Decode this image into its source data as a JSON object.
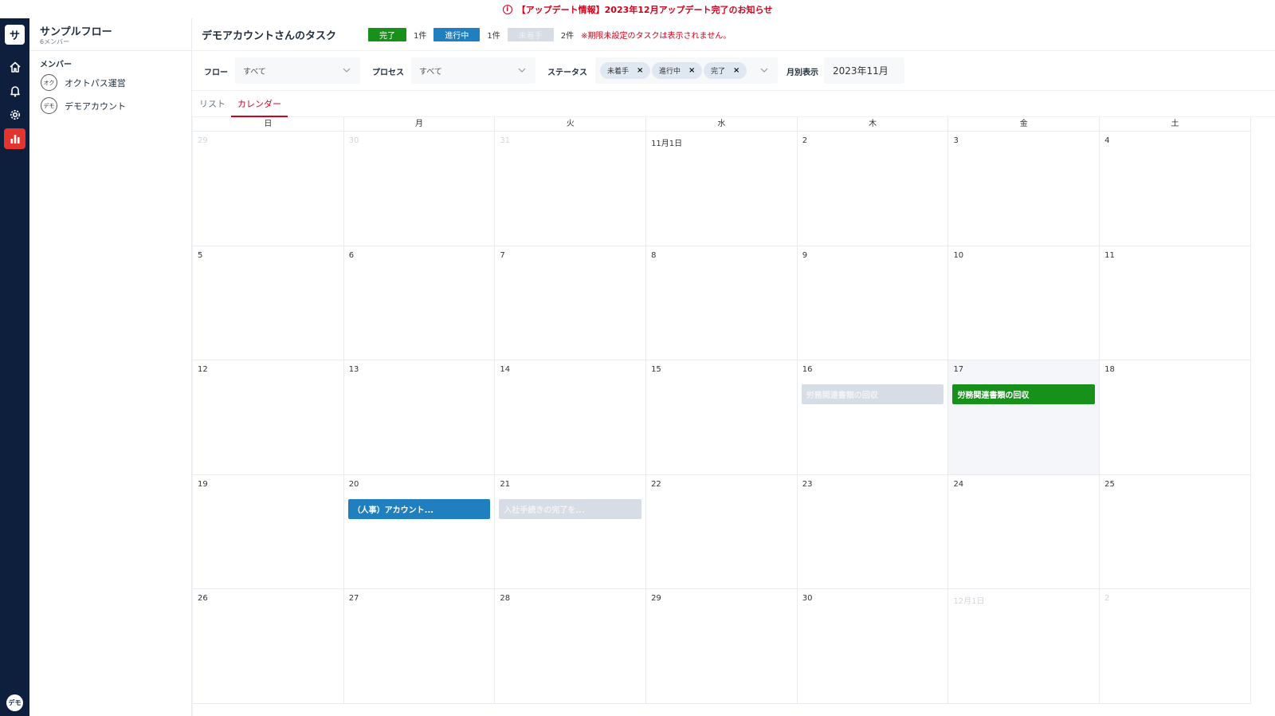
{
  "banner": {
    "text": "【アップデート情報】2023年12月アップデート完了のお知らせ"
  },
  "app": {
    "logo_letter": "サ",
    "user_avatar": "デモ"
  },
  "iconbar": {
    "icons": [
      "home-icon",
      "bell-icon",
      "gear-icon",
      "bar-chart-icon"
    ],
    "active": "bar-chart-icon",
    "active_color": "#e3342f",
    "bg_color": "#0e1f3d"
  },
  "sidebar": {
    "flow_title": "サンプルフロー",
    "flow_sub": "6メンバー",
    "member_heading": "メンバー",
    "members": [
      {
        "avatar": "オク",
        "name": "オクトパス運営"
      },
      {
        "avatar": "デモ",
        "name": "デモアカウント"
      }
    ]
  },
  "header": {
    "title": "デモアカウントさんのタスク",
    "badges": [
      {
        "label": "完了",
        "count": "1件",
        "status": "done",
        "color": "#17911a"
      },
      {
        "label": "進行中",
        "count": "1件",
        "status": "doing",
        "color": "#1f7fbf"
      },
      {
        "label": "未着手",
        "count": "2件",
        "status": "notyet",
        "color": "#d7dde4"
      }
    ],
    "warning": "※期限未設定のタスクは表示されません。"
  },
  "filters": {
    "flow_label": "フロー",
    "flow_value": "すべて",
    "process_label": "プロセス",
    "process_value": "すべて",
    "status_label": "ステータス",
    "status_chips": [
      "未着手",
      "進行中",
      "完了"
    ],
    "month_label": "月別表示",
    "month_value": "2023年11月"
  },
  "tabs": [
    {
      "label": "リスト",
      "active": false
    },
    {
      "label": "カレンダー",
      "active": true
    }
  ],
  "calendar": {
    "weekdays": [
      "日",
      "月",
      "火",
      "水",
      "木",
      "金",
      "土"
    ],
    "weeks": [
      [
        "29",
        "30",
        "31",
        "11月1日",
        "2",
        "3",
        "4"
      ],
      [
        "5",
        "6",
        "7",
        "8",
        "9",
        "10",
        "11"
      ],
      [
        "12",
        "13",
        "14",
        "15",
        "16",
        "17",
        "18"
      ],
      [
        "19",
        "20",
        "21",
        "22",
        "23",
        "24",
        "25"
      ],
      [
        "26",
        "27",
        "28",
        "29",
        "30",
        "12月1日",
        "2"
      ]
    ],
    "other_month_cells": [
      [
        0,
        0
      ],
      [
        0,
        1
      ],
      [
        0,
        2
      ],
      [
        4,
        5
      ],
      [
        4,
        6
      ]
    ],
    "today_cell": [
      2,
      5
    ],
    "events": [
      {
        "week": 2,
        "day": 4,
        "title": "労務関連書類の回収",
        "status": "notyet"
      },
      {
        "week": 2,
        "day": 5,
        "title": "労務関連書類の回収",
        "status": "done"
      },
      {
        "week": 3,
        "day": 1,
        "title": "（人事）アカウント...",
        "status": "doing"
      },
      {
        "week": 3,
        "day": 2,
        "title": "入社手続きの完了を...",
        "status": "notyet"
      }
    ]
  }
}
